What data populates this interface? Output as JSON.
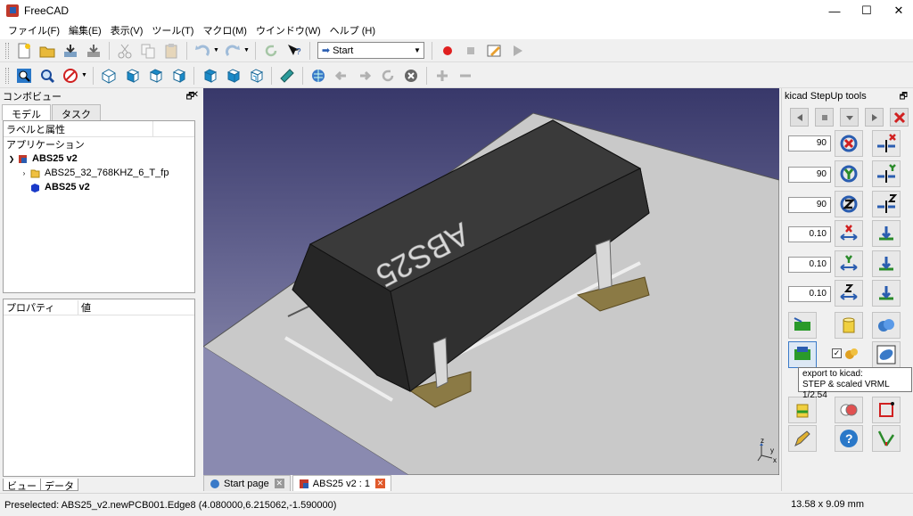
{
  "window": {
    "title": "FreeCAD",
    "minimize": "—",
    "maximize": "☐",
    "close": "✕"
  },
  "menu": [
    "ファイル(F)",
    "編集(E)",
    "表示(V)",
    "ツール(T)",
    "マクロ(M)",
    "ウインドウ(W)",
    "ヘルプ (H)"
  ],
  "toolbar": {
    "workbench": "Start"
  },
  "combo": {
    "title": "コンボビュー",
    "tabs": [
      "モデル",
      "タスク"
    ],
    "labels_header": "ラベルと属性",
    "application": "アプリケーション",
    "tree": [
      {
        "label": "ABS25 v2",
        "bold": true
      },
      {
        "label": "ABS25_32_768KHZ_6_T_fp",
        "bold": false
      },
      {
        "label": "ABS25 v2",
        "bold": true
      }
    ],
    "props_cols": [
      "プロパティ",
      "値"
    ],
    "bottom_tabs": [
      "ビュー",
      "データ"
    ]
  },
  "viewport": {
    "part_label": "ABS25"
  },
  "doc_tabs": [
    {
      "label": "Start page"
    },
    {
      "label": "ABS25 v2 : 1"
    }
  ],
  "ksu": {
    "title": "kicad StepUp tools",
    "inputs": [
      "90",
      "90",
      "90",
      "0.10",
      "0.10",
      "0.10"
    ],
    "tooltip_line1": "export to kicad:",
    "tooltip_line2": "STEP & scaled VRML 1/2.54"
  },
  "status": {
    "preselected": "Preselected: ABS25_v2.newPCB001.Edge8 (4.080000,6.215062,-1.590000)",
    "dimensions": "13.58 x 9.09 mm"
  },
  "colors": {
    "viewport_top": "#38386a",
    "viewport_bottom": "#9c9cb8",
    "pcb": "#c8c8c8",
    "body": "#3a3a3a",
    "pad": "#8b7a45"
  }
}
